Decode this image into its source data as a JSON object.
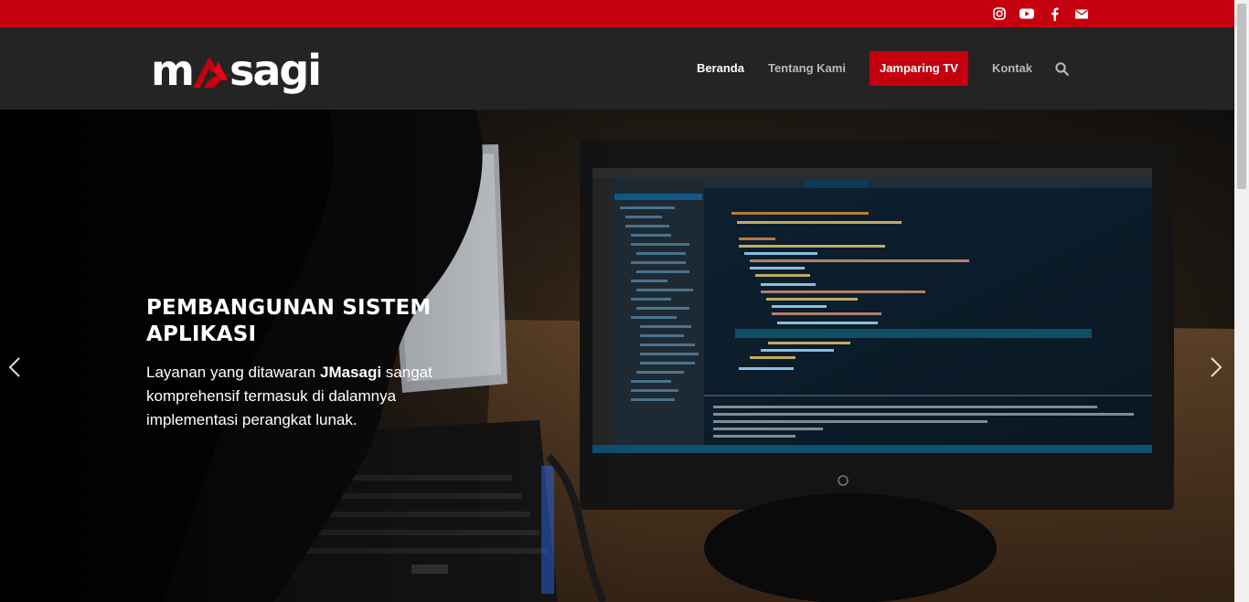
{
  "brand": {
    "logo_text_left": "m",
    "logo_text_right": "sagi",
    "accent_color": "#c4000f"
  },
  "social": [
    {
      "name": "instagram-icon"
    },
    {
      "name": "youtube-icon"
    },
    {
      "name": "facebook-icon"
    },
    {
      "name": "mail-icon"
    }
  ],
  "nav": {
    "items": [
      {
        "label": "Beranda"
      },
      {
        "label": "Tentang Kami"
      },
      {
        "label": "Jamparing TV"
      },
      {
        "label": "Kontak"
      }
    ],
    "search_icon": "search-icon"
  },
  "hero": {
    "title": "PEMBANGUNAN SISTEM APLIKASI",
    "text_prefix": "Layanan yang ditawaran ",
    "text_brand": "JMasagi",
    "text_suffix": " sangat komprehensif termasuk di dalamnya implementasi perangkat lunak."
  }
}
